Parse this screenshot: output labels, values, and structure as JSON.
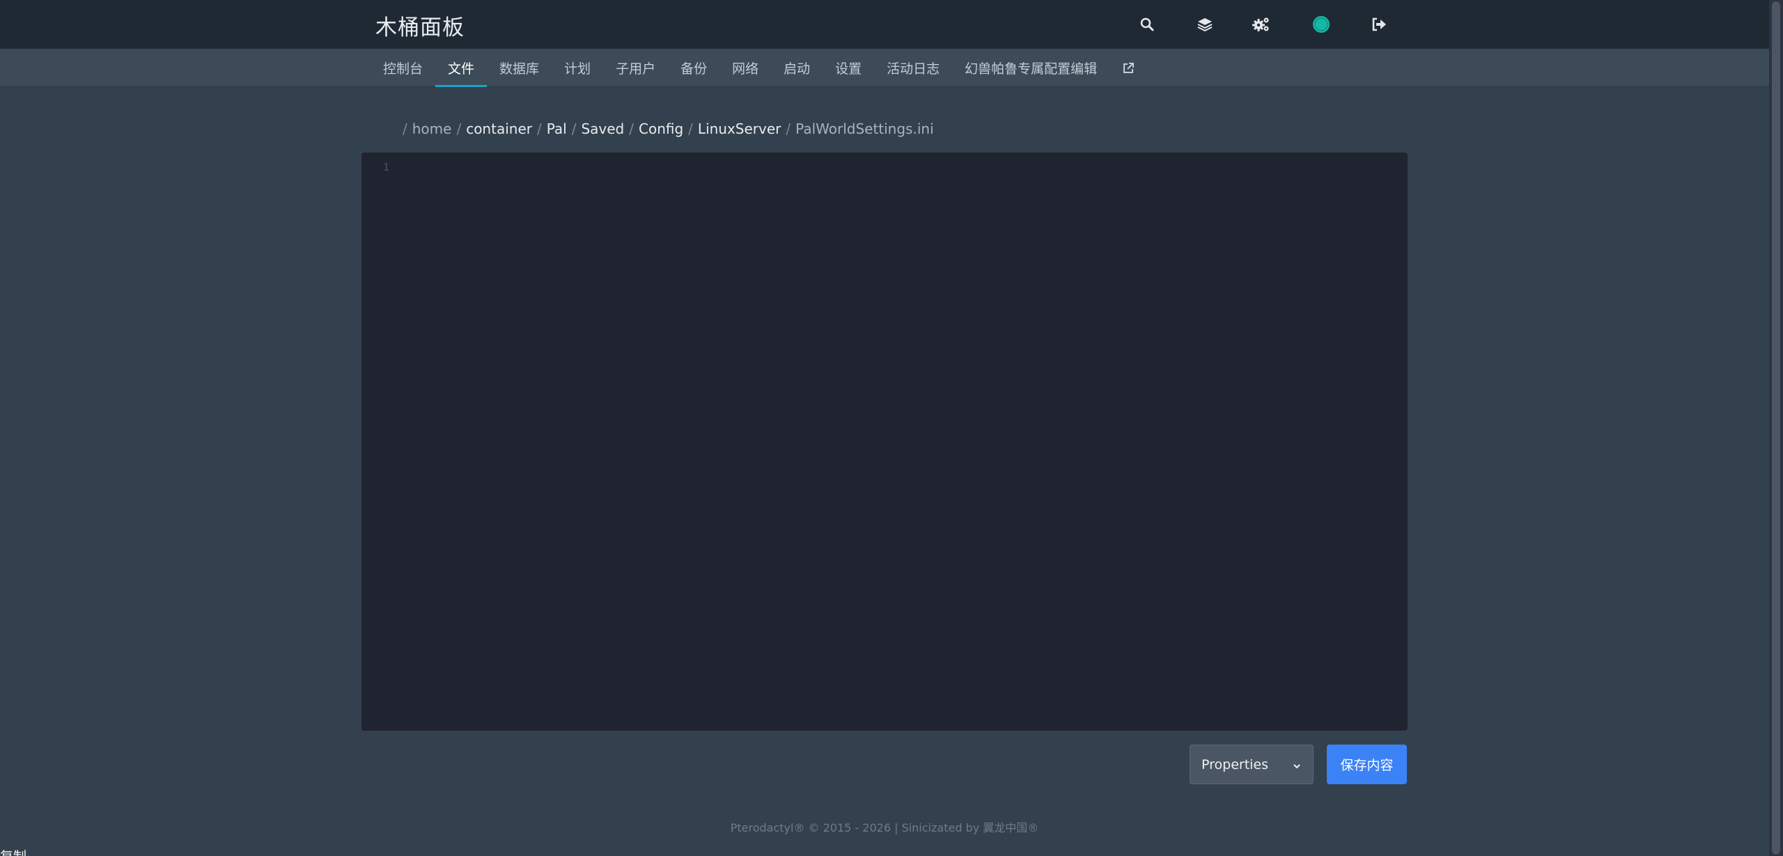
{
  "header": {
    "brand": "木桶面板",
    "icons": [
      "search-icon",
      "layers-icon",
      "gears-icon",
      "avatar",
      "sign-out-icon"
    ],
    "avatar_color": "#14b8a6"
  },
  "nav": {
    "items": [
      {
        "label": "控制台",
        "active": false
      },
      {
        "label": "文件",
        "active": true
      },
      {
        "label": "数据库",
        "active": false
      },
      {
        "label": "计划",
        "active": false
      },
      {
        "label": "子用户",
        "active": false
      },
      {
        "label": "备份",
        "active": false
      },
      {
        "label": "网络",
        "active": false
      },
      {
        "label": "启动",
        "active": false
      },
      {
        "label": "设置",
        "active": false
      },
      {
        "label": "活动日志",
        "active": false
      },
      {
        "label": "幻兽帕鲁专属配置编辑",
        "active": false
      }
    ],
    "external_icon": "external-link-icon",
    "active_color": "#1f9fcf"
  },
  "breadcrumb": {
    "separator": "/",
    "segments": [
      "home",
      "container",
      "Pal",
      "Saved",
      "Config",
      "LinuxServer"
    ],
    "file": "PalWorldSettings.ini"
  },
  "editor": {
    "line_numbers": [
      "1"
    ],
    "content": ""
  },
  "controls": {
    "mode_value": "Properties",
    "save_label": "保存内容",
    "save_color": "#3b82f6"
  },
  "footer": {
    "text": "Pterodactyl® © 2015 - 2026 | Sinicizated by 翼龙中国®"
  },
  "stray_text": "复制"
}
